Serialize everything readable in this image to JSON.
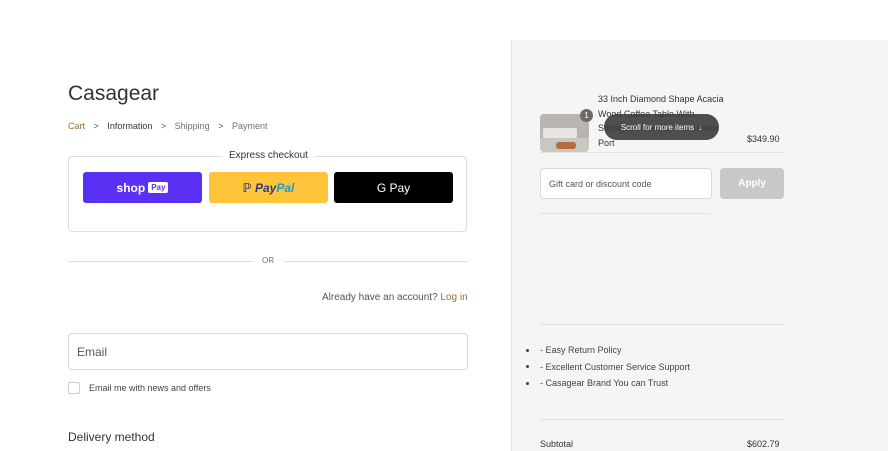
{
  "brand": {
    "name": "Casagear"
  },
  "breadcrumb": {
    "items": [
      "Cart",
      "Information",
      "Shipping",
      "Payment"
    ],
    "separator": ">"
  },
  "express_checkout": {
    "title": "Express checkout",
    "shop_pay": {
      "label": "shop",
      "pill": "Pay",
      "color": "#5a31f4"
    },
    "paypal": {
      "label_p": "Pay",
      "label_pal": "Pal",
      "color": "#ffc439"
    },
    "gpay": {
      "label_g": "G",
      "label_pay": "Pay",
      "color": "#000000"
    }
  },
  "divider_or": "OR",
  "account": {
    "prompt": "Already have an account?",
    "login_link": "Log in"
  },
  "contact": {
    "email_placeholder": "Email",
    "newsletter_label": "Email me with news and offers",
    "newsletter_checked": false
  },
  "delivery": {
    "heading": "Delivery method"
  },
  "order_summary": {
    "product": {
      "name": "33 Inch Diamond Shape Acacia Wood Coffee Table With Storage, Brown By The Urban Port",
      "quantity": "1",
      "price": "$349.90"
    },
    "scroll_hint": {
      "label": "Scroll for more items",
      "icon": "arrow-down-icon"
    },
    "discount": {
      "placeholder": "Gift card or discount code",
      "apply_label": "Apply"
    },
    "benefits": [
      "- Easy Return Policy",
      "- Excellent Customer Service Support",
      "- Casagear Brand You can Trust"
    ],
    "subtotal": {
      "label": "Subtotal",
      "value": "$602.79"
    }
  },
  "colors": {
    "accent_link": "#9a6b3a",
    "panel_bg": "#f5f5f5"
  }
}
